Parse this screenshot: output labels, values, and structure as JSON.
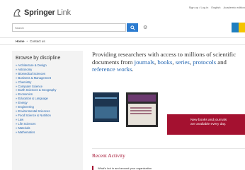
{
  "header": {
    "logo_brand": "Springer",
    "logo_suffix": "Link",
    "top_links": [
      "Sign up / Log in",
      "English",
      "Academic edition"
    ],
    "logo_icon": "springer-horse-icon"
  },
  "search": {
    "placeholder": "Search",
    "button_icon": "search-icon",
    "options_icon": "gear-icon"
  },
  "nav": {
    "home": "Home",
    "separator": "•",
    "contact": "Contact us"
  },
  "sidebar": {
    "title": "Browse by discipline",
    "items": [
      "» Architecture & Design",
      "» Astronomy",
      "» Biomedical Sciences",
      "» Business & Management",
      "» Chemistry",
      "» Computer Science",
      "» Earth Sciences & Geography",
      "» Economics",
      "» Education & Language",
      "» Energy",
      "» Engineering",
      "» Environmental Sciences",
      "» Food Science & Nutrition",
      "» Law",
      "» Life Sciences",
      "» Materials",
      "» Mathematics"
    ]
  },
  "main": {
    "tagline_prefix": "Providing researchers with access to millions of scientific documents from ",
    "link_journals": "journals",
    "comma1": ", ",
    "link_books": "books",
    "comma2": ", ",
    "link_series": "series",
    "comma3": ", ",
    "link_protocols": "protocols",
    "and": " and ",
    "link_reference": "reference works",
    "period": "."
  },
  "promo": {
    "line1": "New books and journals",
    "line2": "are available every day."
  },
  "recent": {
    "title": "Recent Activity",
    "item": "What's hot in and around your organization"
  },
  "colors": {
    "accent_red": "#a41130",
    "link_blue": "#1f63b0",
    "search_blue": "#2c7cd0"
  }
}
